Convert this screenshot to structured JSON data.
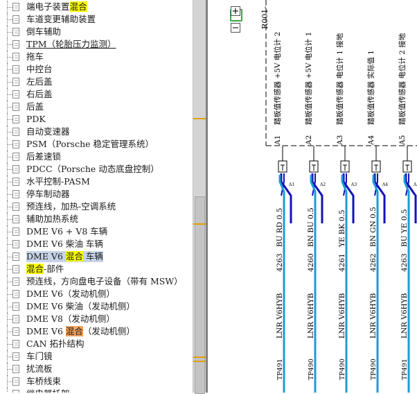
{
  "tree": {
    "items": [
      {
        "parts": [
          {
            "t": "端电子装置"
          },
          {
            "t": "混合",
            "hl": "yellow"
          }
        ]
      },
      {
        "parts": [
          {
            "t": "车道变更辅助装置"
          }
        ]
      },
      {
        "parts": [
          {
            "t": "倒车辅助"
          }
        ]
      },
      {
        "parts": [
          {
            "t": "TPM（轮胎压力监测）",
            "u": true
          }
        ]
      },
      {
        "parts": [
          {
            "t": "拖车"
          }
        ]
      },
      {
        "parts": [
          {
            "t": "中控台"
          }
        ]
      },
      {
        "parts": [
          {
            "t": "左后盖"
          }
        ]
      },
      {
        "parts": [
          {
            "t": "右后盖"
          }
        ]
      },
      {
        "parts": [
          {
            "t": "后盖"
          }
        ]
      },
      {
        "parts": [
          {
            "t": "PDK"
          }
        ]
      },
      {
        "parts": [
          {
            "t": "自动变速器"
          }
        ]
      },
      {
        "parts": [
          {
            "t": "PSM（Porsche 稳定管理系统）"
          }
        ]
      },
      {
        "parts": [
          {
            "t": "后差速锁"
          }
        ]
      },
      {
        "parts": [
          {
            "t": "PDCC（Porsche 动态底盘控制）"
          }
        ]
      },
      {
        "parts": [
          {
            "t": "水平控制-PASM"
          }
        ]
      },
      {
        "parts": [
          {
            "t": "停车制动器"
          }
        ]
      },
      {
        "parts": [
          {
            "t": "预连线，加热-空调系统"
          }
        ]
      },
      {
        "parts": [
          {
            "t": "辅助加热系统"
          }
        ]
      },
      {
        "parts": [
          {
            "t": "DME V6 + V8 车辆"
          }
        ]
      },
      {
        "parts": [
          {
            "t": "DME V6 柴油 车辆"
          }
        ]
      },
      {
        "parts": [
          {
            "t": "DME V6 "
          },
          {
            "t": "混合",
            "hl": "yellow"
          },
          {
            "t": " 车辆"
          }
        ],
        "selected": true
      },
      {
        "parts": [
          {
            "t": "混合",
            "hl": "yellow"
          },
          {
            "t": "-部件"
          }
        ]
      },
      {
        "parts": [
          {
            "t": "预连线，方向盘电子设备（带有 MSW）"
          }
        ]
      },
      {
        "parts": [
          {
            "t": "DME V6（发动机侧）"
          }
        ]
      },
      {
        "parts": [
          {
            "t": "DME V6 柴油（发动机侧）"
          }
        ]
      },
      {
        "parts": [
          {
            "t": "DME V8（发动机侧）"
          }
        ]
      },
      {
        "parts": [
          {
            "t": "DME V6 "
          },
          {
            "t": "混合",
            "hl": "orange"
          },
          {
            "t": "（发动机侧）"
          }
        ]
      },
      {
        "parts": [
          {
            "t": "CAN 拓扑结构"
          }
        ]
      },
      {
        "parts": [
          {
            "t": "车门镜"
          }
        ]
      },
      {
        "parts": [
          {
            "t": "扰流板"
          }
        ]
      },
      {
        "parts": [
          {
            "t": "车桥线束"
          }
        ]
      },
      {
        "parts": [
          {
            "t": "继电器托架"
          }
        ]
      }
    ]
  },
  "scrollbar": {
    "marker_color": "#e0a000"
  },
  "diagram": {
    "zoom_in_label": "+",
    "zoom_out_label": "−",
    "component_id": "R001-",
    "pins": [
      {
        "pin": "A1",
        "desc": "踏板值传感器 +5V 电位计 2",
        "wire": "4263",
        "color": "BU RD 0.5",
        "harness": "LNR V6HYB",
        "tp": "TP491"
      },
      {
        "pin": "A2",
        "desc": "踏板值传感器 +5V 电位计 1",
        "wire": "4260",
        "color": "BN BU 0.5",
        "harness": "LNR V6HYB",
        "tp": "TP490"
      },
      {
        "pin": "A3",
        "desc": "踏板值传感器 电位计 1 接地",
        "wire": "4261",
        "color": "YE BK 0.5",
        "harness": "LNR V6HYB",
        "tp": "TP490"
      },
      {
        "pin": "A4",
        "desc": "踏板值传感器 实际值 1",
        "wire": "4262",
        "color": "BN GN 0.5",
        "harness": "LNR V6HYB",
        "tp": "TP490"
      },
      {
        "pin": "A5",
        "desc": "踏板值传感器 电位计 2 接地",
        "wire": "4263",
        "color": "BU YE 0.5",
        "harness": "LNR V6HYB",
        "tp": "TP491"
      }
    ],
    "colors": {
      "cable": "#1b9bd8",
      "dark": "#1212b8",
      "line": "#000000"
    }
  }
}
